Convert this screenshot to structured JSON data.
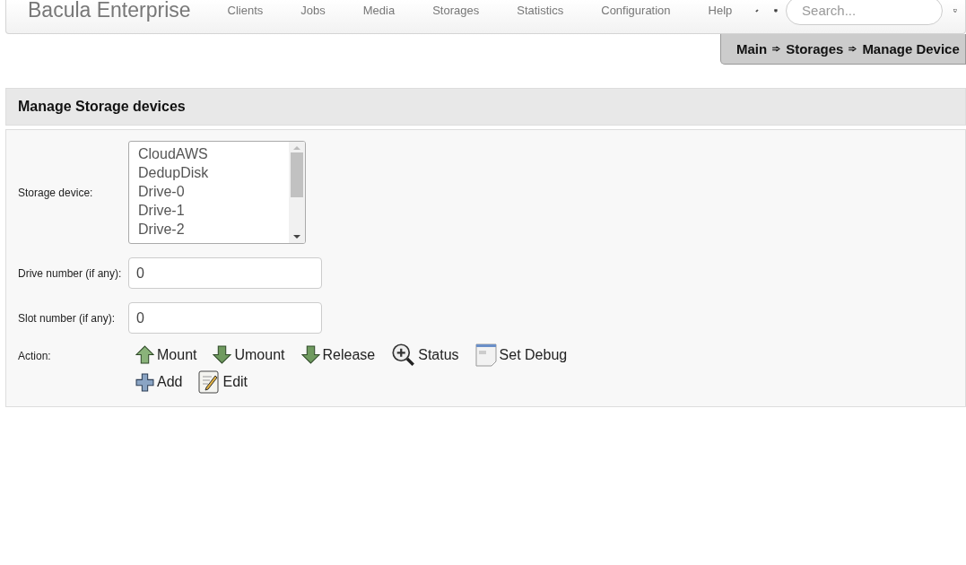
{
  "navbar": {
    "brand": "Bacula Enterprise",
    "items": [
      "Clients",
      "Jobs",
      "Media",
      "Storages",
      "Statistics",
      "Configuration",
      "Help"
    ],
    "search": {
      "placeholder": "Search..."
    }
  },
  "breadcrumb": [
    "Main",
    "Storages",
    "Manage Device"
  ],
  "panel": {
    "title": "Manage Storage devices",
    "storage_device": {
      "label": "Storage device:",
      "options": [
        {
          "text": "CloudAWS",
          "selected": false
        },
        {
          "text": "DedupDisk",
          "selected": false
        },
        {
          "text": "Drive-0",
          "selected": false
        },
        {
          "text": "Drive-1",
          "selected": false
        },
        {
          "text": "Drive-2",
          "selected": false
        }
      ]
    },
    "drive_number": {
      "label": "Drive number (if any):",
      "value": "0"
    },
    "slot_number": {
      "label": "Slot number (if any):",
      "value": "0"
    },
    "action": {
      "label": "Action:",
      "buttons": [
        {
          "kind": "mount",
          "label": "Mount"
        },
        {
          "kind": "umount",
          "label": "Umount"
        },
        {
          "kind": "release",
          "label": "Release"
        },
        {
          "kind": "status",
          "label": "Status"
        },
        {
          "kind": "debug",
          "label": "Set Debug"
        },
        {
          "kind": "add",
          "label": "Add"
        },
        {
          "kind": "edit",
          "label": "Edit"
        }
      ]
    }
  }
}
